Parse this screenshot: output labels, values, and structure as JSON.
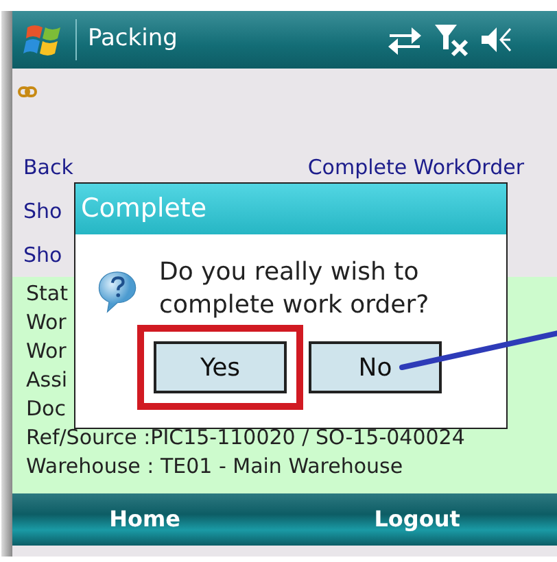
{
  "window": {
    "title": "Packing"
  },
  "nav_links": [
    {
      "label": "Back"
    },
    {
      "label": "Complete WorkOrder"
    }
  ],
  "menu_links": [
    "Sho",
    "Sho"
  ],
  "details": [
    "Stat",
    "Wor",
    "Wor",
    "Assi",
    "Doc",
    "Ref/Source :PIC15-110020 / SO-15-040024",
    "Warehouse : TE01 - Main Warehouse"
  ],
  "dialog": {
    "title": "Complete",
    "message": "Do you really wish to complete work order?",
    "buttons": [
      {
        "label": "Yes",
        "highlighted": true
      },
      {
        "label": "No",
        "highlighted": false
      }
    ]
  },
  "softkeys": [
    "Home",
    "Logout"
  ]
}
